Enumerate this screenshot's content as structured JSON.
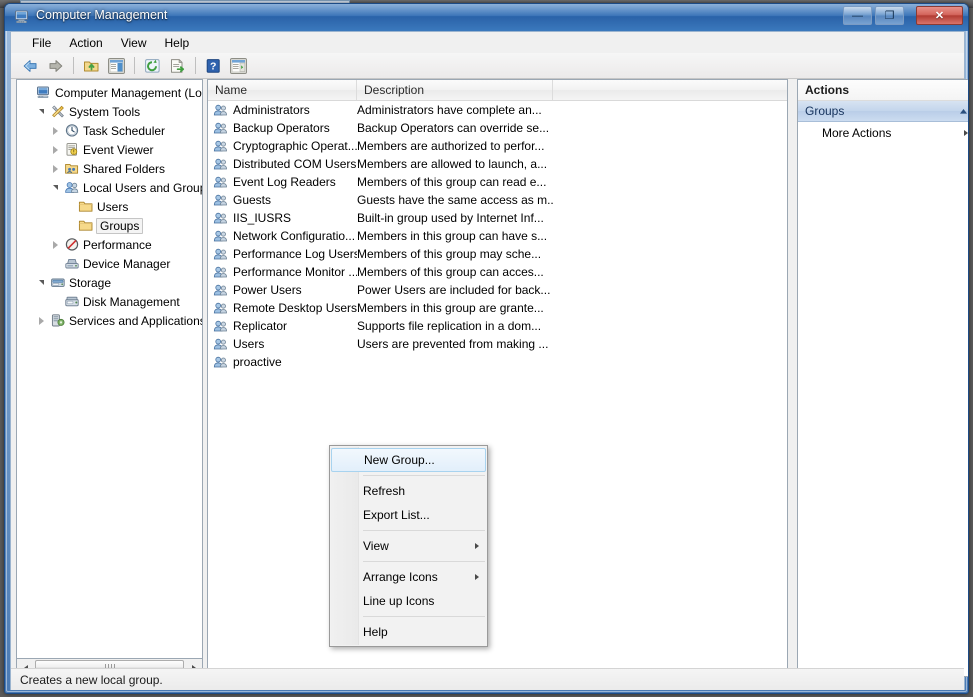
{
  "window": {
    "title": "Computer Management",
    "icon": "computer-management-icon",
    "controls": {
      "minimize": "minimize-button",
      "maximize": "maximize-button",
      "close": "close-button",
      "minimize_glyph": "—",
      "maximize_glyph": "❐",
      "close_glyph": "✕"
    }
  },
  "menubar": {
    "items": [
      {
        "label": "File"
      },
      {
        "label": "Action"
      },
      {
        "label": "View"
      },
      {
        "label": "Help"
      }
    ]
  },
  "toolbar": {
    "buttons": [
      {
        "name": "back-icon"
      },
      {
        "name": "forward-icon"
      },
      {
        "name": "up-folder-icon"
      },
      {
        "name": "show-hide-console-tree-icon"
      },
      {
        "name": "refresh-icon"
      },
      {
        "name": "export-list-icon"
      },
      {
        "name": "help-icon"
      },
      {
        "name": "show-hide-action-pane-icon"
      }
    ]
  },
  "tree": {
    "nodes": [
      {
        "label": "Computer Management (Local",
        "depth": 0,
        "twisty": "none",
        "icon": "computer-icon",
        "selected": false
      },
      {
        "label": "System Tools",
        "depth": 1,
        "twisty": "expanded",
        "icon": "system-tools-icon",
        "selected": false
      },
      {
        "label": "Task Scheduler",
        "depth": 2,
        "twisty": "collapsed",
        "icon": "clock-icon",
        "selected": false
      },
      {
        "label": "Event Viewer",
        "depth": 2,
        "twisty": "collapsed",
        "icon": "event-viewer-icon",
        "selected": false
      },
      {
        "label": "Shared Folders",
        "depth": 2,
        "twisty": "collapsed",
        "icon": "shared-folders-icon",
        "selected": false
      },
      {
        "label": "Local Users and Groups",
        "depth": 2,
        "twisty": "expanded",
        "icon": "users-groups-icon",
        "selected": false
      },
      {
        "label": "Users",
        "depth": 3,
        "twisty": "none",
        "icon": "folder-icon",
        "selected": false
      },
      {
        "label": "Groups",
        "depth": 3,
        "twisty": "none",
        "icon": "folder-icon",
        "selected": true
      },
      {
        "label": "Performance",
        "depth": 2,
        "twisty": "collapsed",
        "icon": "performance-icon",
        "selected": false
      },
      {
        "label": "Device Manager",
        "depth": 2,
        "twisty": "none",
        "icon": "device-manager-icon",
        "selected": false
      },
      {
        "label": "Storage",
        "depth": 1,
        "twisty": "expanded",
        "icon": "storage-icon",
        "selected": false
      },
      {
        "label": "Disk Management",
        "depth": 2,
        "twisty": "none",
        "icon": "disk-management-icon",
        "selected": false
      },
      {
        "label": "Services and Applications",
        "depth": 1,
        "twisty": "collapsed",
        "icon": "services-icon",
        "selected": false
      }
    ],
    "hscroll": {
      "left_arrow": "scroll-left-arrow",
      "right_arrow": "scroll-right-arrow"
    }
  },
  "list": {
    "columns": [
      {
        "label": "Name"
      },
      {
        "label": "Description"
      },
      {
        "label": ""
      }
    ],
    "rows": [
      {
        "name": "Administrators",
        "description": "Administrators have complete an..."
      },
      {
        "name": "Backup Operators",
        "description": "Backup Operators can override se..."
      },
      {
        "name": "Cryptographic Operat...",
        "description": "Members are authorized to perfor..."
      },
      {
        "name": "Distributed COM Users",
        "description": "Members are allowed to launch, a..."
      },
      {
        "name": "Event Log Readers",
        "description": "Members of this group can read e..."
      },
      {
        "name": "Guests",
        "description": "Guests have the same access as m..."
      },
      {
        "name": "IIS_IUSRS",
        "description": "Built-in group used by Internet Inf..."
      },
      {
        "name": "Network Configuratio...",
        "description": "Members in this group can have s..."
      },
      {
        "name": "Performance Log Users",
        "description": "Members of this group may sche..."
      },
      {
        "name": "Performance Monitor ...",
        "description": "Members of this group can acces..."
      },
      {
        "name": "Power Users",
        "description": "Power Users are included for back..."
      },
      {
        "name": "Remote Desktop Users",
        "description": "Members in this group are grante..."
      },
      {
        "name": "Replicator",
        "description": "Supports file replication in a dom..."
      },
      {
        "name": "Users",
        "description": "Users are prevented from making ..."
      },
      {
        "name": "proactive",
        "description": ""
      }
    ]
  },
  "actions": {
    "title": "Actions",
    "group_header": "Groups",
    "group_header_collapse_icon": "chevron-up-icon",
    "items": [
      {
        "label": "More Actions",
        "submenu_icon": "chevron-right-icon"
      }
    ]
  },
  "context_menu": {
    "items": [
      {
        "label": "New Group...",
        "type": "item",
        "highlighted": true,
        "submenu": false
      },
      {
        "type": "separator"
      },
      {
        "label": "Refresh",
        "type": "item",
        "highlighted": false,
        "submenu": false
      },
      {
        "label": "Export List...",
        "type": "item",
        "highlighted": false,
        "submenu": false
      },
      {
        "type": "separator"
      },
      {
        "label": "View",
        "type": "item",
        "highlighted": false,
        "submenu": true
      },
      {
        "type": "separator"
      },
      {
        "label": "Arrange Icons",
        "type": "item",
        "highlighted": false,
        "submenu": true
      },
      {
        "label": "Line up Icons",
        "type": "item",
        "highlighted": false,
        "submenu": false
      },
      {
        "type": "separator"
      },
      {
        "label": "Help",
        "type": "item",
        "highlighted": false,
        "submenu": false
      }
    ]
  },
  "statusbar": {
    "text": "Creates a new local group."
  },
  "colors": {
    "titlebar_blue": "#2f6cb4",
    "close_red": "#b23c33",
    "selection_blue": "#c3d5ec",
    "menu_highlight": "#e2effb",
    "folder_yellow": "#f6d98a"
  }
}
